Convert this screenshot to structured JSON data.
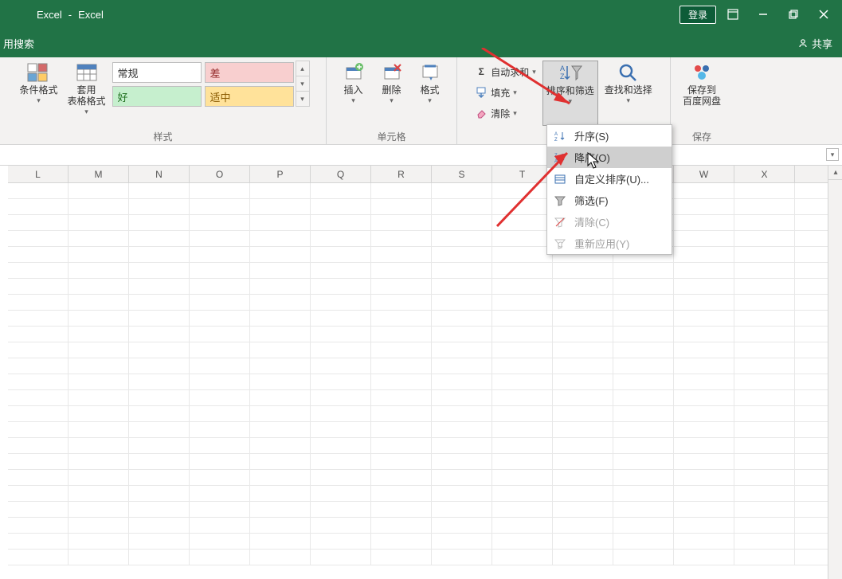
{
  "title": {
    "app": "Excel",
    "sep": "-",
    "doc": "Excel"
  },
  "win": {
    "login": "登录"
  },
  "topstrip": {
    "search": "用搜索",
    "share": "共享"
  },
  "ribbon": {
    "styles": {
      "label": "样式",
      "cond_format": "条件格式",
      "table_format": "套用\n表格格式",
      "swatch_normal": "常规",
      "swatch_bad": "差",
      "swatch_good": "好",
      "swatch_mid": "适中"
    },
    "cells": {
      "label": "单元格",
      "insert": "插入",
      "delete": "删除",
      "format": "格式"
    },
    "editing": {
      "autosum": "自动求和",
      "fill": "填充",
      "clear": "清除",
      "sort_filter": "排序和筛选",
      "find_select": "查找和选择"
    },
    "save": {
      "label": "保存",
      "save_baidu": "保存到\n百度网盘"
    }
  },
  "menu": {
    "asc": "升序(S)",
    "desc": "降序(O)",
    "custom": "自定义排序(U)...",
    "filter": "筛选(F)",
    "clear": "清除(C)",
    "reapply": "重新应用(Y)"
  },
  "columns": [
    "L",
    "M",
    "N",
    "O",
    "P",
    "Q",
    "R",
    "S",
    "T",
    "",
    "",
    "W",
    "X"
  ],
  "grid_rows": 24
}
